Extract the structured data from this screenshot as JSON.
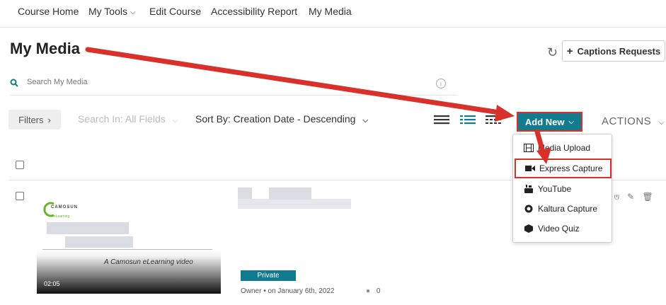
{
  "nav": {
    "items": [
      "Course Home",
      "My Tools",
      "Edit Course",
      "Accessibility Report",
      "My Media"
    ]
  },
  "page": {
    "title": "My Media"
  },
  "captions_button": {
    "label": "Captions Requests"
  },
  "search": {
    "placeholder": "Search My Media"
  },
  "filters": {
    "filters_label": "Filters",
    "search_in": "Search In: All Fields",
    "sort_by": "Sort By: Creation Date - Descending"
  },
  "add_new": {
    "label": "Add New"
  },
  "actions": {
    "label": "ACTIONS"
  },
  "menu": {
    "items": [
      {
        "label": "Media Upload",
        "icon": "film-icon"
      },
      {
        "label": "Express Capture",
        "icon": "video-camera-icon"
      },
      {
        "label": "YouTube",
        "icon": "youtube-icon"
      },
      {
        "label": "Kaltura Capture",
        "icon": "record-icon"
      },
      {
        "label": "Video Quiz",
        "icon": "cube-icon"
      }
    ]
  },
  "media_entry": {
    "logo_text": "CAMOSUN",
    "logo_sub": "eLearning",
    "tagline": "A Camosun eLearning video",
    "duration": "02:05",
    "status": "Private",
    "owner": "Owner",
    "date": "on January 6th, 2022",
    "comments": "0"
  },
  "colors": {
    "accent": "#117c90",
    "highlight": "#d9302c"
  }
}
